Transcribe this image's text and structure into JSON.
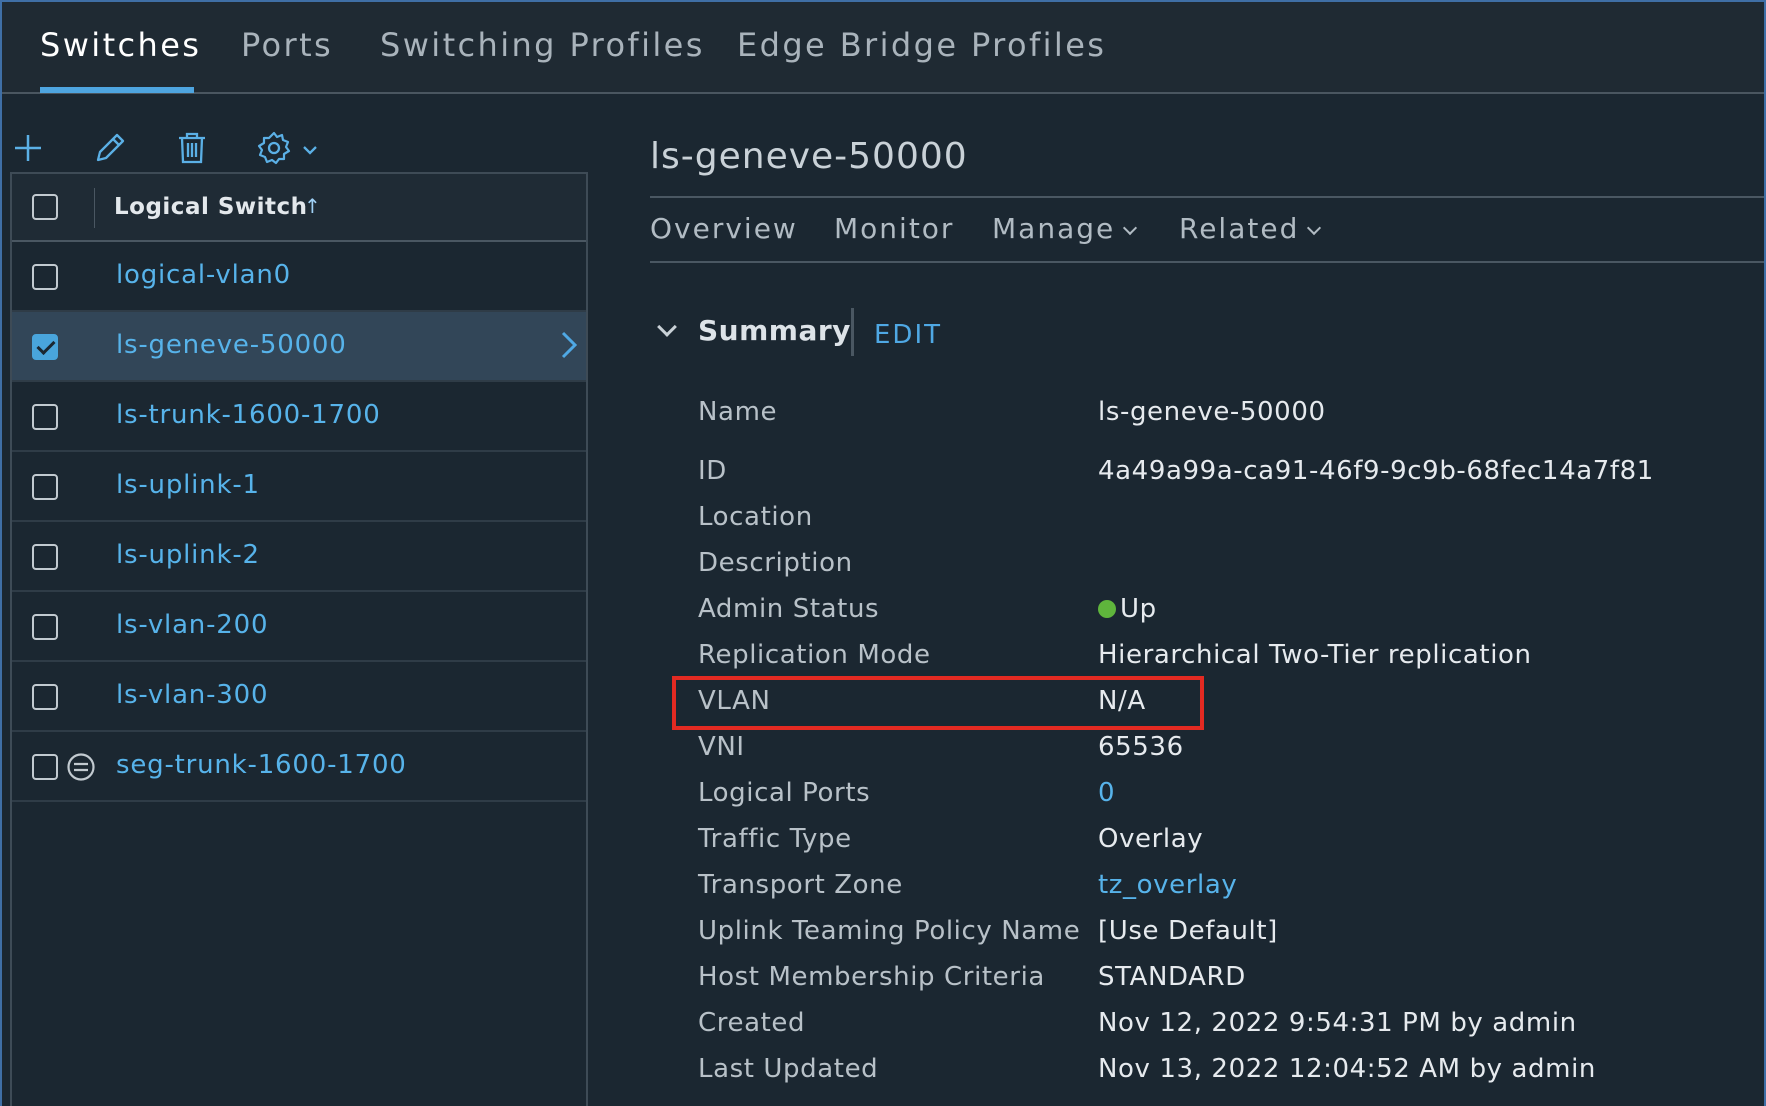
{
  "top_tabs": [
    "Switches",
    "Ports",
    "Switching Profiles",
    "Edge Bridge Profiles"
  ],
  "toolbar": {
    "add_icon": "plus-icon",
    "edit_icon": "pencil-icon",
    "delete_icon": "trash-icon",
    "settings_icon": "gear-icon"
  },
  "list": {
    "header": "Logical Switch",
    "sort_indicator": "↑",
    "rows": [
      {
        "label": "logical-vlan0",
        "checked": false,
        "selected": false
      },
      {
        "label": "ls-geneve-50000",
        "checked": true,
        "selected": true
      },
      {
        "label": "ls-trunk-1600-1700",
        "checked": false,
        "selected": false
      },
      {
        "label": "ls-uplink-1",
        "checked": false,
        "selected": false
      },
      {
        "label": "ls-uplink-2",
        "checked": false,
        "selected": false
      },
      {
        "label": "ls-vlan-200",
        "checked": false,
        "selected": false
      },
      {
        "label": "ls-vlan-300",
        "checked": false,
        "selected": false
      },
      {
        "label": "seg-trunk-1600-1700",
        "checked": false,
        "selected": false,
        "status_icon": "disabled-icon"
      }
    ]
  },
  "detail": {
    "title": "ls-geneve-50000",
    "tabs": [
      "Overview",
      "Monitor",
      "Manage",
      "Related"
    ],
    "summary_title": "Summary",
    "edit_label": "EDIT",
    "properties": [
      {
        "label": "Name",
        "value": "ls-geneve-50000"
      },
      {
        "label": "ID",
        "value": "4a49a99a-ca91-46f9-9c9b-68fec14a7f81"
      },
      {
        "label": "Location",
        "value": ""
      },
      {
        "label": "Description",
        "value": ""
      },
      {
        "label": "Admin Status",
        "value": "Up"
      },
      {
        "label": "Replication Mode",
        "value": "Hierarchical Two-Tier replication"
      },
      {
        "label": "VLAN",
        "value": "N/A"
      },
      {
        "label": "VNI",
        "value": "65536"
      },
      {
        "label": "Logical Ports",
        "value": "0"
      },
      {
        "label": "Traffic Type",
        "value": "Overlay"
      },
      {
        "label": "Transport Zone",
        "value": "tz_overlay"
      },
      {
        "label": "Uplink Teaming Policy Name",
        "value": "[Use Default]"
      },
      {
        "label": "Host Membership Criteria",
        "value": "STANDARD"
      },
      {
        "label": "Created",
        "value": "Nov 12, 2022 9:54:31 PM by admin"
      },
      {
        "label": "Last Updated",
        "value": "Nov 13, 2022 12:04:52 AM by admin"
      }
    ]
  },
  "colors": {
    "accent": "#4ea5e0",
    "link": "#57b3ea",
    "status_up": "#5fb53c",
    "highlight": "#e32a22"
  }
}
